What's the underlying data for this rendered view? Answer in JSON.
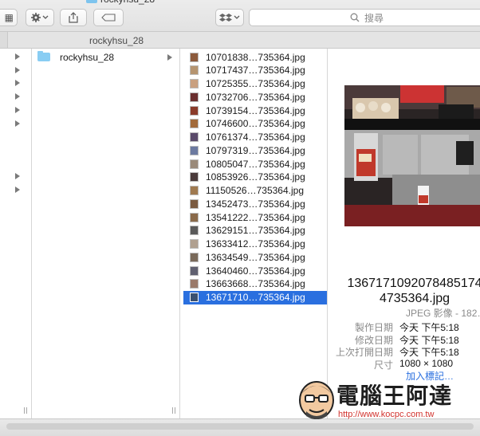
{
  "window": {
    "title_fragment": "rockyhsu_28"
  },
  "toolbar": {
    "view_icon": "grid-icon",
    "view_label": "▦",
    "action_icon": "gear-icon",
    "share_icon": "share-icon",
    "tag_icon": "tag-icon",
    "dropbox_icon": "dropbox-icon",
    "search_placeholder": "搜尋"
  },
  "pathbar": {
    "label": "rockyhsu_28"
  },
  "sidebar_column": {
    "expand_arrow_rows": [
      0,
      1,
      2,
      3,
      4,
      5,
      9,
      10
    ]
  },
  "folder_column": {
    "items": [
      {
        "label": "rockyhsu_28",
        "selected": false
      }
    ]
  },
  "file_column": {
    "files": [
      "10701838…735364.jpg",
      "10717437…735364.jpg",
      "10725355…735364.jpg",
      "10732706…735364.jpg",
      "10739154…735364.jpg",
      "10746600…735364.jpg",
      "10761374…735364.jpg",
      "10797319…735364.jpg",
      "10805047…735364.jpg",
      "10853926…735364.jpg",
      "11150526…735364.jpg",
      "13452473…735364.jpg",
      "13541222…735364.jpg",
      "13629151…735364.jpg",
      "13633412…735364.jpg",
      "13634549…735364.jpg",
      "13640460…735364.jpg",
      "13663668…735364.jpg",
      "13671710…735364.jpg"
    ],
    "selected_index": 18
  },
  "preview": {
    "filename_line1": "1367171092078485174",
    "filename_line2": "4735364.jpg",
    "kind": "JPEG 影像 - 182…",
    "meta": [
      {
        "key": "製作日期",
        "value": "今天 下午5:18"
      },
      {
        "key": "修改日期",
        "value": "今天 下午5:18"
      },
      {
        "key": "上次打開日期",
        "value": "今天 下午5:18"
      },
      {
        "key": "尺寸",
        "value": "1080 × 1080"
      }
    ],
    "add_tags": "加入標記…"
  },
  "watermark": {
    "title": "電腦王阿達",
    "url": "http://www.kocpc.com.tw"
  },
  "colors": {
    "selection": "#2a6fdf",
    "folder": "#89cdf3",
    "watermark_url": "#d2322d"
  }
}
